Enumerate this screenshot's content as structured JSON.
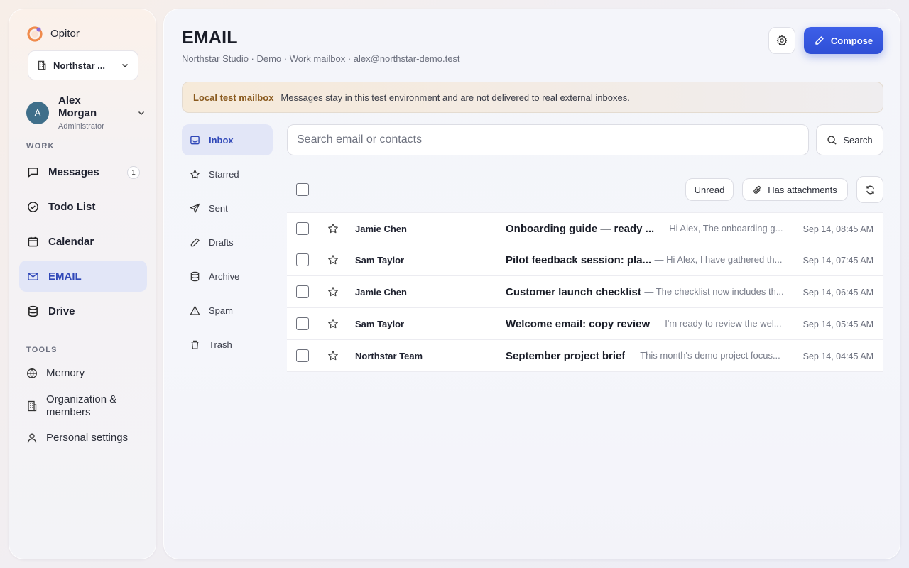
{
  "brand": {
    "name": "Opitor"
  },
  "workspace": {
    "label": "Northstar ..."
  },
  "user": {
    "initial": "A",
    "name": "Alex Morgan",
    "role": "Administrator"
  },
  "sidebar": {
    "work_label": "WORK",
    "tools_label": "TOOLS",
    "work_items": [
      {
        "label": "Messages",
        "badge": "1",
        "icon": "message-icon"
      },
      {
        "label": "Todo List",
        "icon": "check-circle-icon"
      },
      {
        "label": "Calendar",
        "icon": "calendar-icon"
      },
      {
        "label": "EMAIL",
        "icon": "mail-icon",
        "active": true
      },
      {
        "label": "Drive",
        "icon": "database-icon"
      }
    ],
    "tool_items": [
      {
        "label": "Memory",
        "icon": "globe-icon"
      },
      {
        "label": "Organization & members",
        "icon": "building-icon"
      },
      {
        "label": "Personal settings",
        "icon": "user-icon"
      }
    ]
  },
  "header": {
    "title": "EMAIL",
    "subtitle": "Northstar Studio · Demo · Work mailbox · alex@northstar-demo.test",
    "compose_label": "Compose"
  },
  "notice": {
    "title": "Local test mailbox",
    "text": "Messages stay in this test environment and are not delivered to real external inboxes."
  },
  "folders": [
    {
      "label": "Inbox",
      "icon": "inbox-icon",
      "active": true
    },
    {
      "label": "Starred",
      "icon": "star-icon"
    },
    {
      "label": "Sent",
      "icon": "send-icon"
    },
    {
      "label": "Drafts",
      "icon": "pencil-icon"
    },
    {
      "label": "Archive",
      "icon": "archive-icon"
    },
    {
      "label": "Spam",
      "icon": "warning-icon"
    },
    {
      "label": "Trash",
      "icon": "trash-icon"
    }
  ],
  "search": {
    "placeholder": "Search email or contacts",
    "button_label": "Search"
  },
  "filters": {
    "unread_label": "Unread",
    "attachments_label": "Has attachments"
  },
  "emails": [
    {
      "sender": "Jamie Chen",
      "subject": "Onboarding guide — ready ...",
      "snippet": "— Hi Alex, The onboarding g...",
      "date": "Sep 14, 08:45 AM"
    },
    {
      "sender": "Sam Taylor",
      "subject": "Pilot feedback session: pla...",
      "snippet": "— Hi Alex, I have gathered th...",
      "date": "Sep 14, 07:45 AM"
    },
    {
      "sender": "Jamie Chen",
      "subject": "Customer launch checklist",
      "snippet": "— The checklist now includes th...",
      "date": "Sep 14, 06:45 AM"
    },
    {
      "sender": "Sam Taylor",
      "subject": "Welcome email: copy review",
      "snippet": "— I'm ready to review the wel...",
      "date": "Sep 14, 05:45 AM"
    },
    {
      "sender": "Northstar Team",
      "subject": "September project brief",
      "snippet": "— This month's demo project focus...",
      "date": "Sep 14, 04:45 AM"
    }
  ],
  "colors": {
    "accent": "#2f4fd6",
    "active_bg": "#e2e6f7",
    "notice_title": "#8a5a1e"
  }
}
